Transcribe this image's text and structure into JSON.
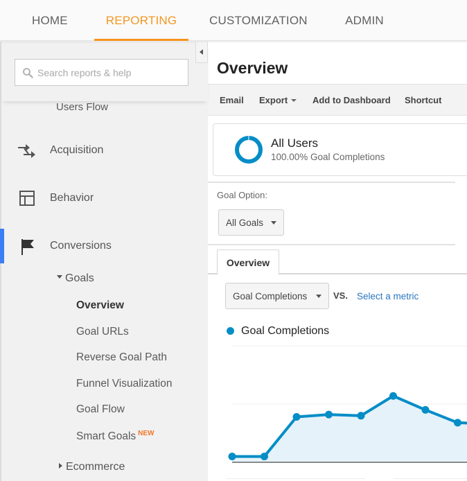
{
  "topnav": {
    "tabs": [
      {
        "label": "HOME",
        "active": false
      },
      {
        "label": "REPORTING",
        "active": true
      },
      {
        "label": "CUSTOMIZATION",
        "active": false
      },
      {
        "label": "ADMIN",
        "active": false
      }
    ],
    "accent_color": "#f7941d"
  },
  "sidebar": {
    "search": {
      "placeholder": "Search reports & help",
      "value": ""
    },
    "users_flow_label": "Users Flow",
    "sections": [
      {
        "label": "Acquisition",
        "icon": "acquisition-arrows-icon",
        "active": false
      },
      {
        "label": "Behavior",
        "icon": "behavior-layout-icon",
        "active": false
      },
      {
        "label": "Conversions",
        "icon": "flag-icon",
        "active": true
      }
    ],
    "goals": {
      "label": "Goals",
      "expanded": true,
      "items": [
        {
          "label": "Overview",
          "active": true
        },
        {
          "label": "Goal URLs",
          "active": false
        },
        {
          "label": "Reverse Goal Path",
          "active": false
        },
        {
          "label": "Funnel Visualization",
          "active": false
        },
        {
          "label": "Goal Flow",
          "active": false
        },
        {
          "label": "Smart Goals",
          "active": false,
          "badge": "NEW"
        }
      ]
    },
    "ecommerce": {
      "label": "Ecommerce",
      "expanded": false
    },
    "active_indicator_color": "#3c7ef3"
  },
  "main": {
    "title": "Overview",
    "toolbar": {
      "email": "Email",
      "export": "Export",
      "add_to_dashboard": "Add to Dashboard",
      "shortcut": "Shortcut"
    },
    "segment": {
      "name": "All Users",
      "summary": "100.00% Goal Completions",
      "color": "#058dc7"
    },
    "goal_option": {
      "label": "Goal Option:",
      "selected": "All Goals"
    },
    "tabs": [
      {
        "label": "Overview",
        "active": true
      }
    ],
    "metric_selector": {
      "selected": "Goal Completions",
      "vs_label": "VS.",
      "compare_link": "Select a metric"
    },
    "legend": {
      "label": "Goal Completions",
      "color": "#058dc7"
    }
  },
  "chart_data": {
    "type": "area",
    "title": "",
    "xlabel": "",
    "ylabel": "",
    "series": [
      {
        "name": "Goal Completions",
        "color": "#058dc7",
        "fill": "#e5f2f9",
        "values": [
          0.5,
          0.5,
          3.9,
          4.1,
          4.0,
          5.7,
          4.5,
          3.4,
          3.3
        ]
      }
    ],
    "x": [
      1,
      2,
      3,
      4,
      5,
      6,
      7,
      8,
      9
    ],
    "ylim": [
      0,
      10
    ],
    "gridlines": [
      5,
      10
    ],
    "grid": true,
    "note": "Axis tick labels not visible; values are relative estimates from gridlines; chart is cropped at the right edge."
  }
}
